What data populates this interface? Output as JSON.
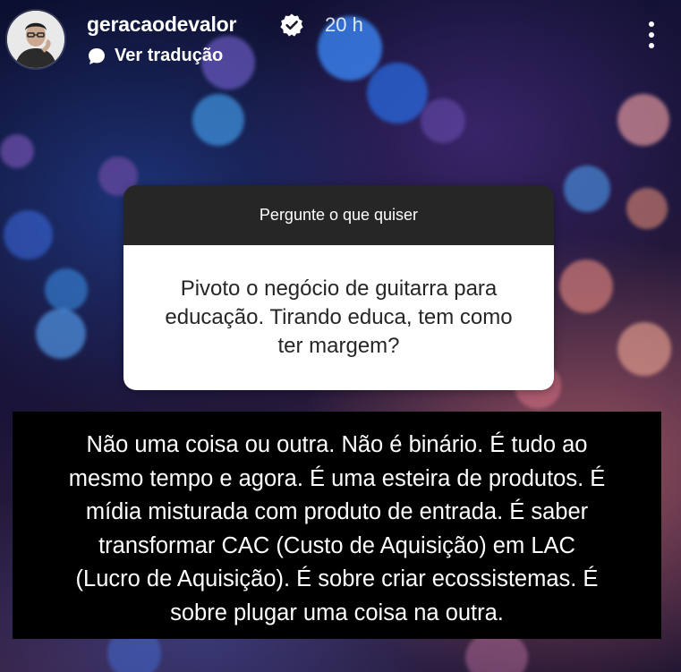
{
  "header": {
    "username": "geracaodevalor",
    "time": "20 h",
    "translate_label": "Ver tradução"
  },
  "question_card": {
    "title": "Pergunte o que quiser",
    "question": "Pivoto o negócio de guitarra para educação. Tirando educa, tem como ter margem?"
  },
  "answer": {
    "lines": [
      "Não uma coisa ou outra. Não é binário. É tudo ao",
      "mesmo tempo e agora. É uma esteira de produtos. É",
      "mídia misturada com produto de entrada. É saber",
      "transformar CAC (Custo de Aquisição) em LAC",
      "(Lucro de Aquisição). É sobre criar ecossistemas. É",
      "sobre plugar uma coisa na outra."
    ]
  },
  "colors": {
    "verified_badge": "#ffffff",
    "card_header": "#262626",
    "answer_bg": "#000000"
  },
  "icons": [
    "verified-badge-icon",
    "translate-icon",
    "more-options-icon"
  ]
}
